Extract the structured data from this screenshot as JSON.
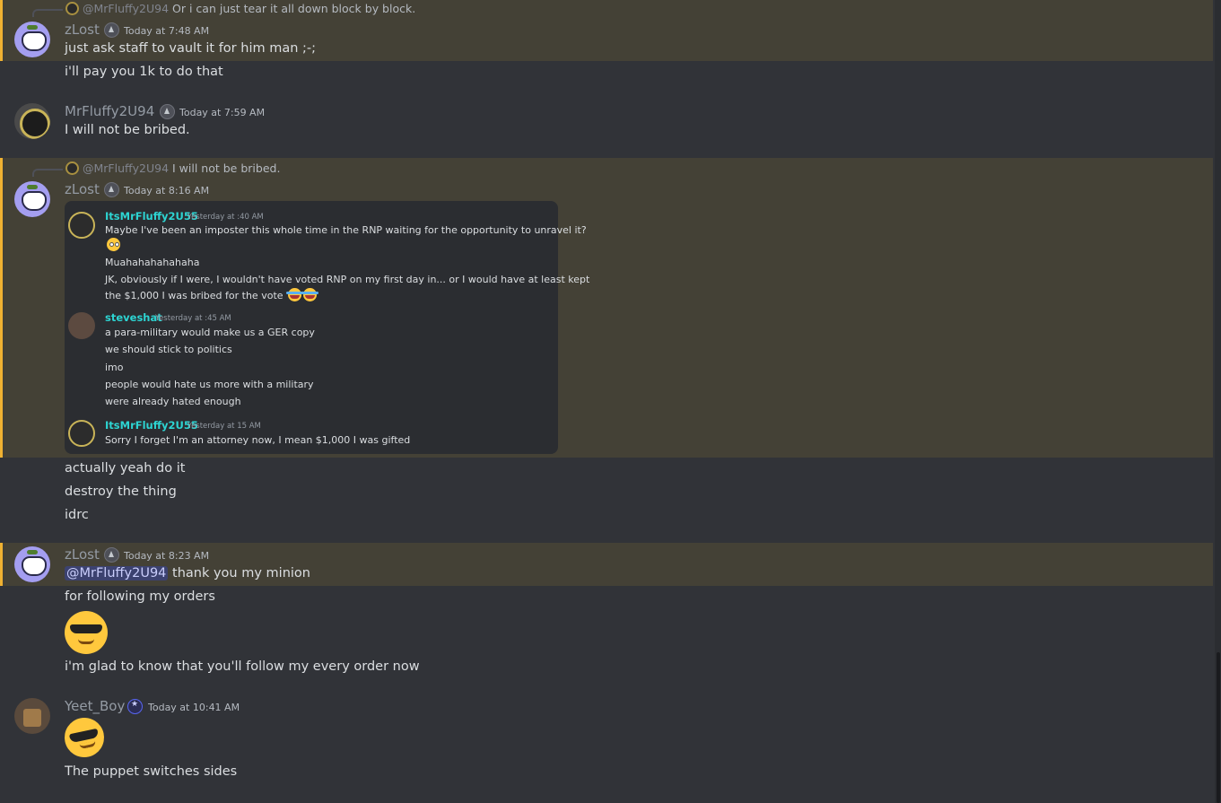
{
  "colors": {
    "background": "#313338",
    "highlight": "#444136",
    "highlight_border": "#f0b232",
    "embed_name": "#2dd4d2",
    "mention_bg": "#3c4270"
  },
  "messages": [
    {
      "reply": {
        "name": "@MrFluffy2U94",
        "text": "Or i can just tear it all down block by block."
      },
      "author": "zLost",
      "badge_icon": "crown-badge-icon",
      "timestamp": "Today at 7:48 AM",
      "lines": [
        "just ask staff to vault it for him man ;-;",
        "i'll pay you 1k to do that"
      ]
    },
    {
      "author": "MrFluffy2U94",
      "badge_icon": "crown-badge-icon",
      "timestamp": "Today at 7:59 AM",
      "lines": [
        "I will not be bribed."
      ]
    },
    {
      "reply": {
        "name": "@MrFluffy2U94",
        "text": "I will not be bribed."
      },
      "author": "zLost",
      "badge_icon": "crown-badge-icon",
      "timestamp": "Today at 8:16 AM",
      "embed": {
        "groups": [
          {
            "name": "ItsMrFluffy2U55",
            "time": "Yesterday at  :40 AM",
            "lines": [
              "Maybe I've been an imposter this whole time in the RNP waiting for the opportunity to unravel it?",
              "Muahahahahahaha",
              "JK, obviously if I were, I wouldn't have voted RNP on my first day in... or I would have at least kept",
              "the $1,000 I was bribed for the vote"
            ]
          },
          {
            "name": "steveshat",
            "time": "Yesterday at  :45 AM",
            "lines": [
              "a para-military would make us a GER copy",
              "we should stick to politics",
              "imo",
              "people would hate us more with a military",
              "were already hated enough"
            ]
          },
          {
            "name": "ItsMrFluffy2U55",
            "time": "Yesterday at   15 AM",
            "lines": [
              "Sorry I forget I'm an attorney now, I mean $1,000 I was gifted"
            ]
          }
        ]
      },
      "lines": [
        "actually yeah do it",
        "destroy the thing",
        "idrc"
      ]
    },
    {
      "author": "zLost",
      "badge_icon": "crown-badge-icon",
      "timestamp": "Today at 8:23 AM",
      "mention": "@MrFluffy2U94",
      "lines": [
        "thank you my minion",
        "for following my orders",
        "i'm glad to know that you'll follow my every order now"
      ],
      "emoji": "sunglasses-emoji"
    },
    {
      "author": "Yeet_Boy",
      "badge_icon": "star-badge-icon",
      "timestamp": "Today at 10:41 AM",
      "emoji": "sunglasses-emoji-tilted",
      "lines": [
        "The puppet switches sides"
      ]
    }
  ]
}
